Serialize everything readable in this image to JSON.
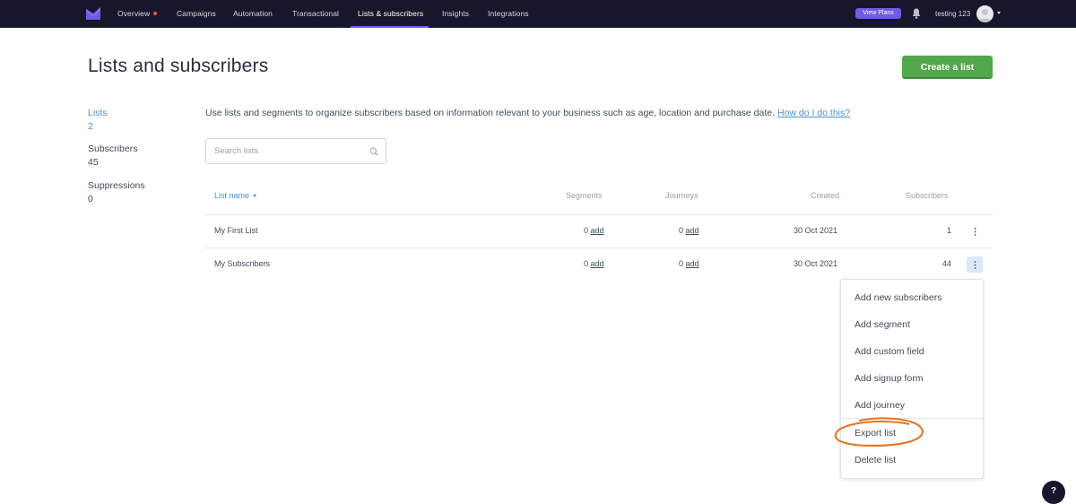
{
  "nav": {
    "items": [
      {
        "label": "Overview",
        "has_dot": true
      },
      {
        "label": "Campaigns"
      },
      {
        "label": "Automation"
      },
      {
        "label": "Transactional"
      },
      {
        "label": "Lists & subscribers",
        "active": true
      },
      {
        "label": "Insights"
      },
      {
        "label": "Integrations"
      }
    ],
    "view_plans": "View Plans",
    "username": "testing 123"
  },
  "page": {
    "title": "Lists and subscribers",
    "create_button": "Create a list",
    "intro_text": "Use lists and segments to organize subscribers based on information relevant to your business such as age, location and purchase date.",
    "intro_link": "How do I do this?",
    "search_placeholder": "Search lists"
  },
  "sidebar": {
    "lists": {
      "label": "Lists",
      "value": "2"
    },
    "subscribers": {
      "label": "Subscribers",
      "value": "45"
    },
    "suppressions": {
      "label": "Suppressions",
      "value": "0"
    }
  },
  "table": {
    "headers": {
      "name": "List name",
      "segments": "Segments",
      "journeys": "Journeys",
      "created": "Created",
      "subscribers": "Subscribers"
    },
    "rows": [
      {
        "name": "My First List",
        "segments": "0",
        "journeys": "0",
        "add": "add",
        "created": "30 Oct 2021",
        "subscribers": "1"
      },
      {
        "name": "My Subscribers",
        "segments": "0",
        "journeys": "0",
        "add": "add",
        "created": "30 Oct 2021",
        "subscribers": "44"
      }
    ]
  },
  "menu": {
    "items": [
      "Add new subscribers",
      "Add segment",
      "Add custom field",
      "Add signup form",
      "Add journey",
      "Export list",
      "Delete list"
    ]
  },
  "help_label": "?",
  "colors": {
    "accent": "#6f5ae6",
    "primary_button": "#52a84b",
    "link": "#4a8fd1",
    "nav_bg": "#16172b",
    "highlight_circle": "#e8731e"
  }
}
